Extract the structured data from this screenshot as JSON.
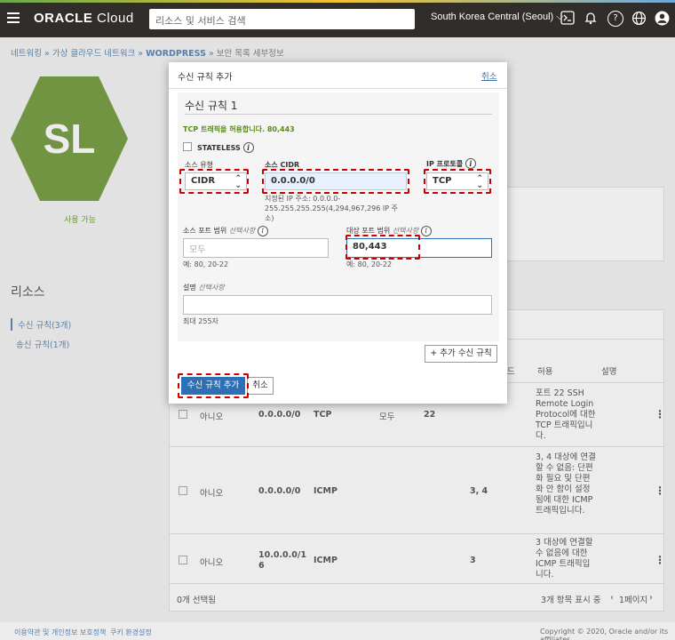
{
  "topbar": {
    "logo_main": "ORACLE",
    "logo_light": " Cloud",
    "search_placeholder": "리소스 및 서비스 검색",
    "region": "South Korea Central (Seoul)",
    "region_chevron": "chevron-down-icon",
    "icons": [
      "cloud-shell-icon",
      "bell-icon",
      "help-icon",
      "globe-icon",
      "user-icon"
    ]
  },
  "breadcrumb": {
    "items": [
      "네트워킹",
      "가상 클라우드 네트워크",
      "WORDPRESS"
    ],
    "sep": " » ",
    "current": "보안 목록 세부정보"
  },
  "resource": {
    "badge": "SL",
    "status": "사용 가능",
    "title": "리소스",
    "nav": [
      "수신 규칙(3개)",
      "송신 규칙(1개)"
    ]
  },
  "table": {
    "columns": {
      "allow": "허용",
      "desc": "설명",
      "dest_port_tail": "드"
    },
    "rows": [
      {
        "stateless": "아니오",
        "source": "0.0.0.0/0",
        "protocol": "TCP",
        "src_port": "모두",
        "dst_port": "22",
        "type_code": "",
        "allow": "포트 22 SSH Remote Login Protocol에 대한 TCP 트래픽입니다."
      },
      {
        "stateless": "아니오",
        "source": "0.0.0.0/0",
        "protocol": "ICMP",
        "src_port": "",
        "dst_port": "",
        "type_code": "3, 4",
        "allow": "3, 4 대상에 연결할 수 없음: 단편화 필요 및 단편화 안 함이 설정됨에 대한 ICMP 트래픽입니다."
      },
      {
        "stateless": "아니오",
        "source": "10.0.0.0/16",
        "protocol": "ICMP",
        "src_port": "",
        "dst_port": "",
        "type_code": "3",
        "allow": "3 대상에 연결할 수 없음에 대한 ICMP 트래픽입니다."
      }
    ],
    "selected": "0개 선택됨",
    "showing": "3개 항목 표시 중",
    "page": "1페이지"
  },
  "modal": {
    "title": "수신 규칙 추가",
    "cancel_link": "취소",
    "rule_title": "수신 규칙 1",
    "tcp_note": "TCP 트래픽을 허용합니다. 80,443",
    "stateless_label": "STATELESS",
    "source_type_label": "소스 유형",
    "source_type_value": "CIDR",
    "source_cidr_label": "소스 CIDR",
    "source_cidr_value": "0.0.0.0/0",
    "cidr_hint": "지정된 IP 주소: 0.0.0.0-255.255.255.255(4,294,967,296 IP 주소)",
    "ip_protocol_label": "IP 프로토콜",
    "ip_protocol_value": "TCP",
    "src_port_label": "소스 포트 범위",
    "optional": "선택사항",
    "src_port_placeholder": "모두",
    "src_port_hint": "예: 80, 20-22",
    "dst_port_label": "대상 포트 범위",
    "dst_port_value": "80,443",
    "dst_port_hint": "예: 80, 20-22",
    "desc_label": "설명",
    "desc_hint": "최대 255자",
    "add_another": "+ 추가 수신 규칙",
    "submit": "수신 규칙 추가",
    "cancel_btn": "취소"
  },
  "footer": {
    "terms": "이용약관 및 개인정보 보호정책",
    "cookies": "쿠키 환경설정",
    "copyright": "Copyright © 2020, Oracle and/or its affiliates."
  },
  "colors": {
    "accent_blue": "#2f6fb4",
    "highlight_red": "#cc0000",
    "status_green": "#5a8a1c"
  }
}
